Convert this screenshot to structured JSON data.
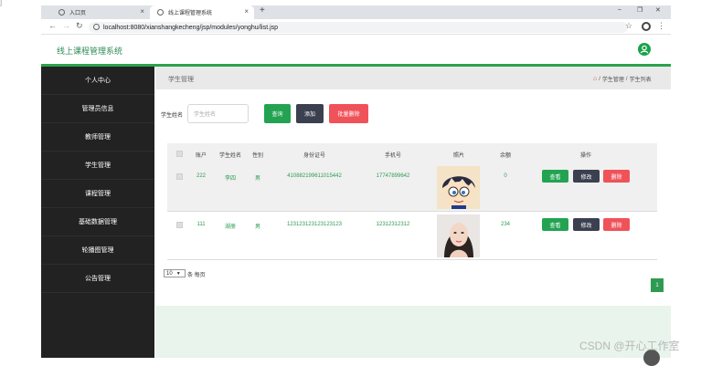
{
  "browser": {
    "tabs": [
      {
        "label": "入口页",
        "close": "×"
      },
      {
        "label": "线上课程管理系统",
        "close": "×"
      }
    ],
    "new_tab": "+",
    "window_controls": [
      "–",
      "❐",
      "✕"
    ],
    "url": "localhost:8080/xianshangkecheng/jsp/modules/yonghu/list.jsp"
  },
  "app": {
    "title": "线上课程管理系统",
    "accent_color": "#29a34b"
  },
  "sidebar": {
    "items": [
      {
        "label": "个人中心"
      },
      {
        "label": "管理员信息"
      },
      {
        "label": "教师管理"
      },
      {
        "label": "学生管理"
      },
      {
        "label": "课程管理"
      },
      {
        "label": "基础数据管理"
      },
      {
        "label": "轮播图管理"
      },
      {
        "label": "公告管理"
      }
    ]
  },
  "page": {
    "title": "学生管理",
    "breadcrumbs": [
      "学生管理",
      "学生列表"
    ],
    "breadcrumb_sep": "/"
  },
  "search": {
    "label": "学生姓名",
    "placeholder": "学生姓名",
    "query_label": "查询",
    "add_label": "添加",
    "batch_delete_label": "批量删除"
  },
  "table": {
    "headers": [
      "账户",
      "学生姓名",
      "性别",
      "身份证号",
      "手机号",
      "照片",
      "余额",
      "操作"
    ],
    "rows": [
      {
        "account": "222",
        "name": "李四",
        "gender": "男",
        "id_card": "410882199611015442",
        "phone": "17747899642",
        "photo": "cartoon-avatar",
        "balance": "0"
      },
      {
        "account": "111",
        "name": "湖册",
        "gender": "男",
        "id_card": "123123123123123123",
        "phone": "12312312312",
        "photo": "woman-portrait",
        "balance": "234"
      }
    ],
    "action_view": "查看",
    "action_edit": "修改",
    "action_delete": "删除"
  },
  "pagination": {
    "page_size": "10",
    "page_size_suffix": "条 每页",
    "current_page": "1"
  },
  "watermark": "CSDN @开心工作室",
  "corner_mark": "]"
}
